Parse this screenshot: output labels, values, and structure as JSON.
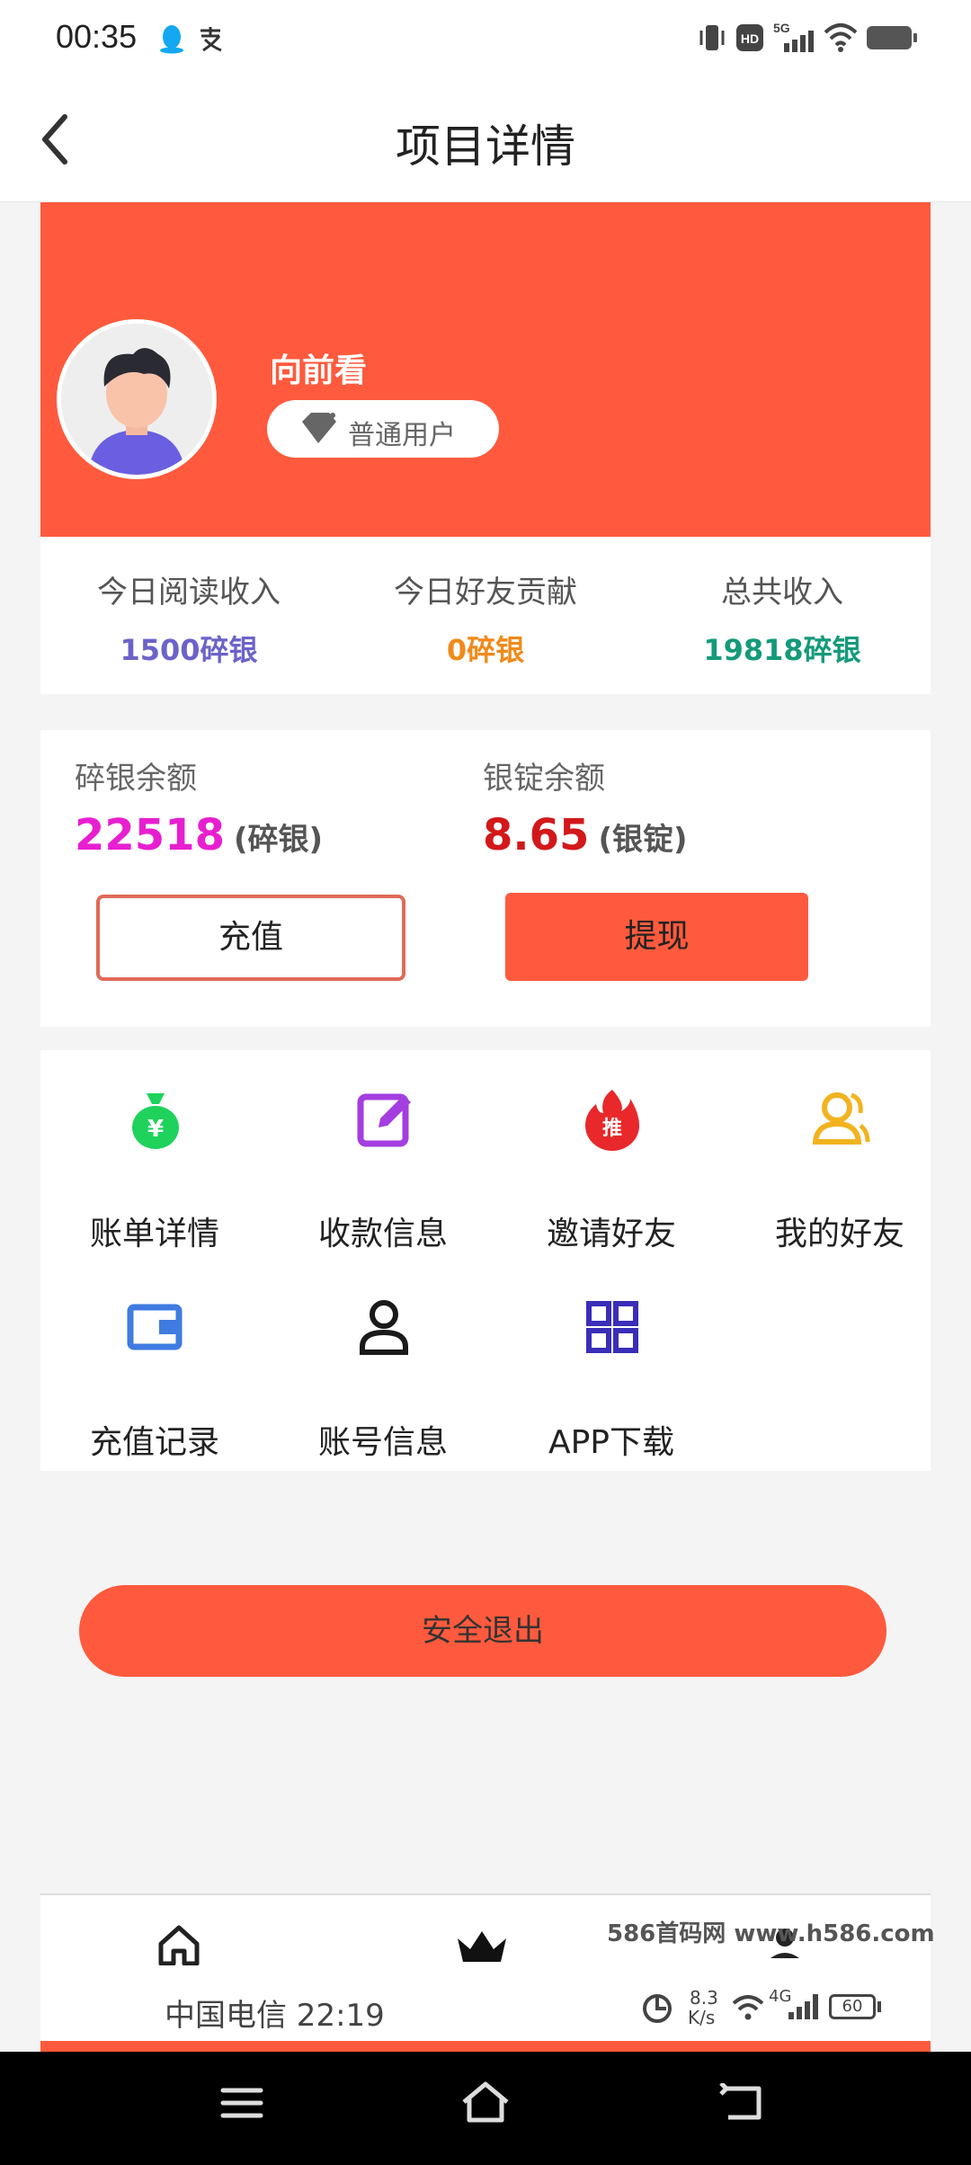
{
  "status_bar": {
    "time": "00:35"
  },
  "header": {
    "title": "项目详情"
  },
  "profile": {
    "username": "向前看",
    "badge_label": "普通用户"
  },
  "stats": [
    {
      "label": "今日阅读收入",
      "value": "1500碎银",
      "color": "#6b63c8"
    },
    {
      "label": "今日好友贡献",
      "value": "0碎银",
      "color": "#f08a1a"
    },
    {
      "label": "总共收入",
      "value": "19818碎银",
      "color": "#159a7a"
    }
  ],
  "balance": {
    "silver_label": "碎银余额",
    "silver_value": "22518",
    "silver_unit": "(碎银)",
    "silver_color": "#e81fd0",
    "ingot_label": "银锭余额",
    "ingot_value": "8.65",
    "ingot_unit": "(银锭)",
    "ingot_color": "#d3181a",
    "recharge_button": "充值",
    "withdraw_button": "提现"
  },
  "menu": [
    {
      "label": "账单详情",
      "icon": "money-bag-icon"
    },
    {
      "label": "收款信息",
      "icon": "edit-icon"
    },
    {
      "label": "邀请好友",
      "icon": "fire-invite-icon"
    },
    {
      "label": "我的好友",
      "icon": "friends-icon"
    },
    {
      "label": "充值记录",
      "icon": "wallet-icon"
    },
    {
      "label": "账号信息",
      "icon": "user-icon"
    },
    {
      "label": "APP下载",
      "icon": "grid-icon"
    }
  ],
  "logout_button": "安全退出",
  "watermark": "586首码网 www.h586.com",
  "inner_status": {
    "carrier": "中国电信 22:19",
    "speed": "8.3",
    "speed_unit": "K/s",
    "net": "4G",
    "battery": "60"
  },
  "accent_color": "#ff5a3d"
}
